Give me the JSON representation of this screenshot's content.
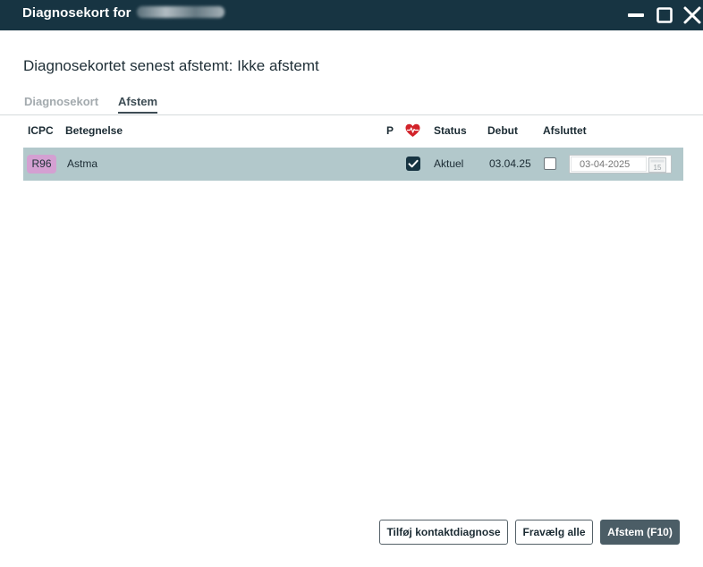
{
  "window": {
    "title": "Diagnosekort for"
  },
  "heading": "Diagnosekortet senest afstemt: Ikke afstemt",
  "tabs": [
    {
      "label": "Diagnosekort",
      "active": false
    },
    {
      "label": "Afstem",
      "active": true
    }
  ],
  "table": {
    "columns": {
      "icpc": "ICPC",
      "betegnelse": "Betegnelse",
      "p": "P",
      "heart_icon": "heart-pulse-icon",
      "status": "Status",
      "debut": "Debut",
      "afsluttet": "Afsluttet"
    },
    "rows": [
      {
        "icpc": "R96",
        "betegnelse": "Astma",
        "p_checked": true,
        "status": "Aktuel",
        "debut": "03.04.25",
        "afsluttet_checked": false,
        "afsluttet_date_placeholder": "03-04-2025",
        "calendar_icon_day": "15"
      }
    ]
  },
  "buttons": {
    "add_contact_diagnosis": "Tilføj kontaktdiagnose",
    "deselect_all": "Fravælg alle",
    "afstem": "Afstem (F10)"
  },
  "colors": {
    "titlebar": "#173442",
    "row_selected": "#b2c8cb",
    "icpc_badge": "#d4a0d2",
    "primary_button": "#4b5d66",
    "heart": "#d2232a"
  }
}
